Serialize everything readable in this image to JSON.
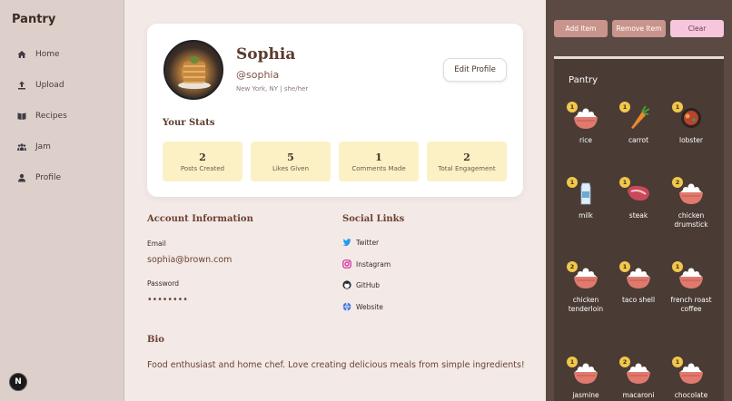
{
  "sidebar": {
    "brand": "Pantry",
    "items": [
      {
        "label": "Home",
        "icon": "home-icon"
      },
      {
        "label": "Upload",
        "icon": "upload-icon"
      },
      {
        "label": "Recipes",
        "icon": "book-icon"
      },
      {
        "label": "Jam",
        "icon": "group-icon"
      },
      {
        "label": "Profile",
        "icon": "person-icon"
      }
    ],
    "badge": "N"
  },
  "profile": {
    "name": "Sophia",
    "handle": "@sophia",
    "location": "New York, NY | she/her",
    "edit_label": "Edit Profile",
    "stats_title": "Your Stats",
    "stats": [
      {
        "value": "2",
        "label": "Posts Created"
      },
      {
        "value": "5",
        "label": "Likes Given"
      },
      {
        "value": "1",
        "label": "Comments Made"
      },
      {
        "value": "2",
        "label": "Total Engagement"
      }
    ]
  },
  "account": {
    "title": "Account Information",
    "email_label": "Email",
    "email": "sophia@brown.com",
    "password_label": "Password",
    "password": "••••••••"
  },
  "social": {
    "title": "Social Links",
    "links": [
      {
        "label": "Twitter",
        "icon": "twitter-icon",
        "color": "#1d9bf0"
      },
      {
        "label": "Instagram",
        "icon": "instagram-icon",
        "color": "#d6249f"
      },
      {
        "label": "GitHub",
        "icon": "github-icon",
        "color": "#24292f"
      },
      {
        "label": "Website",
        "icon": "globe-icon",
        "color": "#3b6fd8"
      }
    ]
  },
  "bio": {
    "title": "Bio",
    "text": "Food enthusiast and home chef. Love creating delicious meals from simple ingredients!"
  },
  "pantry": {
    "add_label": "Add Item",
    "remove_label": "Remove Item",
    "clear_label": "Clear",
    "title": "Pantry",
    "items": [
      {
        "name": "rice",
        "count": "1",
        "icon": "rice-bowl-icon"
      },
      {
        "name": "carrot",
        "count": "1",
        "icon": "carrot-icon"
      },
      {
        "name": "lobster",
        "count": "1",
        "icon": "lobster-icon"
      },
      {
        "name": "milk",
        "count": "1",
        "icon": "milk-icon"
      },
      {
        "name": "steak",
        "count": "1",
        "icon": "steak-icon"
      },
      {
        "name": "chicken drumstick",
        "count": "2",
        "icon": "rice-bowl-icon"
      },
      {
        "name": "chicken tenderloin",
        "count": "2",
        "icon": "rice-bowl-icon"
      },
      {
        "name": "taco shell",
        "count": "1",
        "icon": "rice-bowl-icon"
      },
      {
        "name": "french roast coffee",
        "count": "1",
        "icon": "rice-bowl-icon"
      },
      {
        "name": "jasmine",
        "count": "1",
        "icon": "rice-bowl-icon"
      },
      {
        "name": "macaroni",
        "count": "2",
        "icon": "rice-bowl-icon"
      },
      {
        "name": "chocolate",
        "count": "1",
        "icon": "rice-bowl-icon"
      }
    ]
  }
}
